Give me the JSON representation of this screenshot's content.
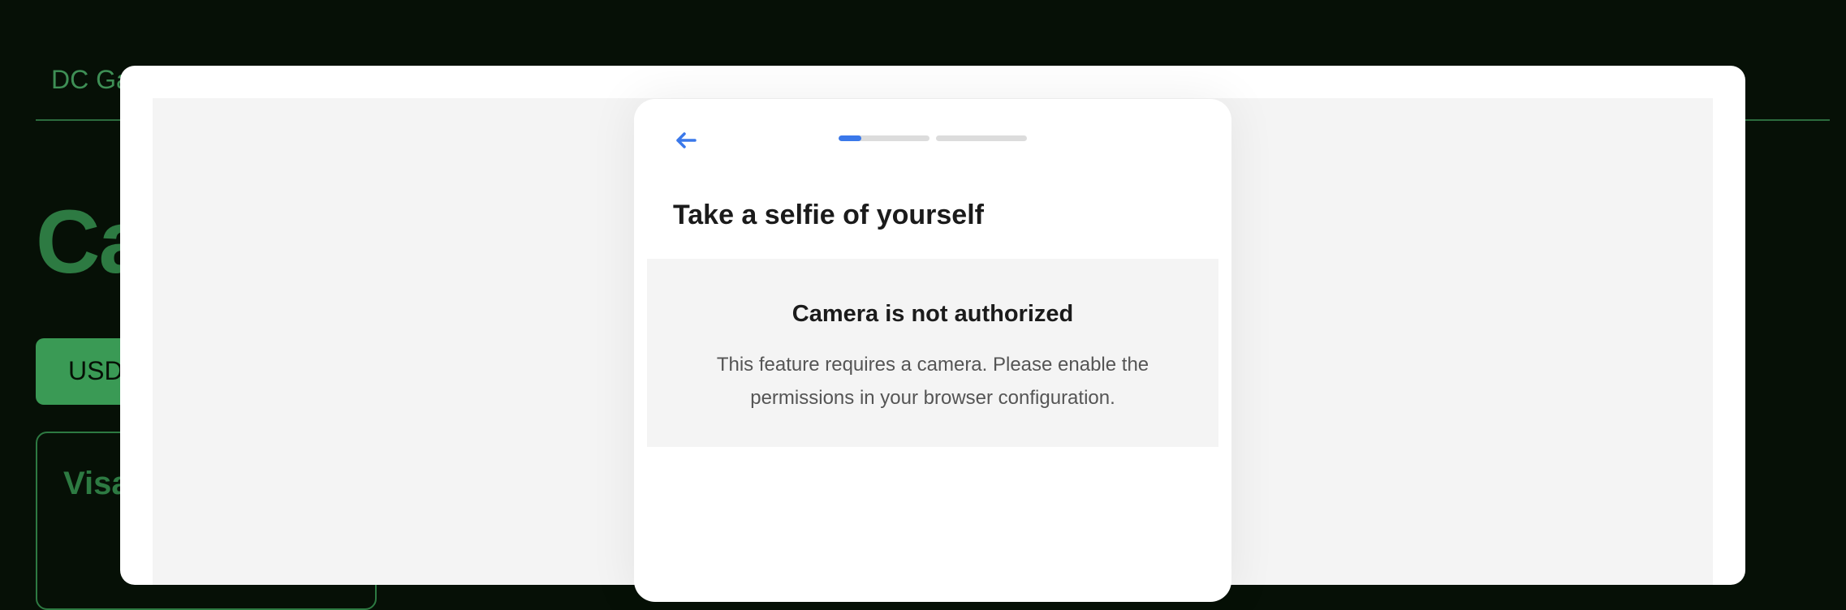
{
  "background": {
    "brand": "DC Ga",
    "heading": "Ca",
    "currency_label": "USD",
    "card_title": "Visa"
  },
  "progress": {
    "steps": 2,
    "current_step_fraction": 0.25
  },
  "verification": {
    "back_icon": "arrow-left-icon",
    "title": "Take a selfie of yourself",
    "notice_title": "Camera is not authorized",
    "notice_body": "This feature requires a camera. Please enable the permissions in your browser configuration."
  },
  "colors": {
    "accent": "#3a78ea",
    "page_bg": "#061006",
    "brand_green": "#3e8f55"
  }
}
